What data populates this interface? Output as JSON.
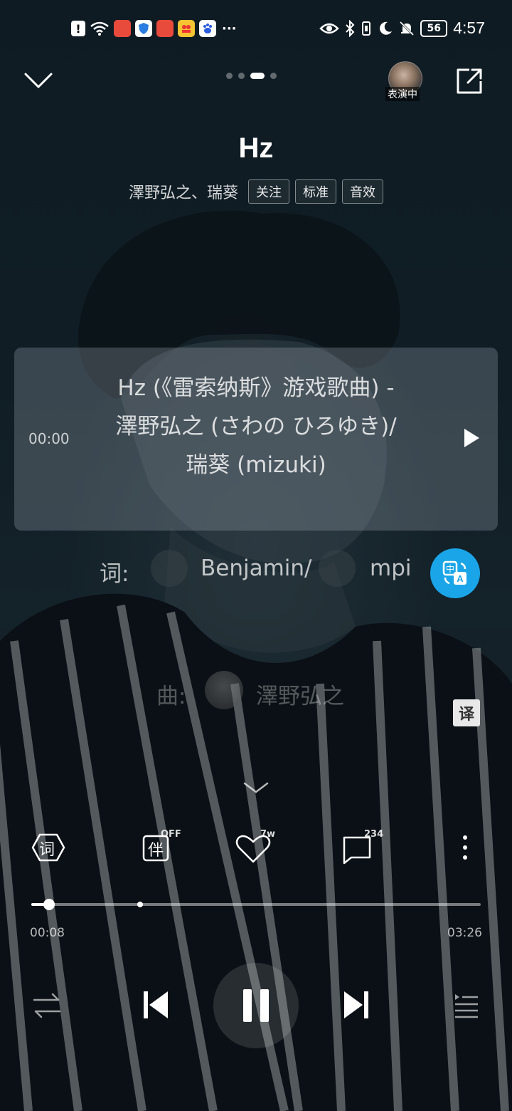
{
  "status_bar": {
    "time": "4:57",
    "battery": "56",
    "more_indicator": "···",
    "icons": [
      "alert-icon",
      "wifi-icon",
      "huawei-app-icon",
      "shield-app-icon",
      "huawei-app-icon-2",
      "video-app-icon",
      "baidu-app-icon",
      "eye-icon",
      "bluetooth-icon",
      "vibrate-icon",
      "moon-icon",
      "mute-bell-icon"
    ]
  },
  "top_bar": {
    "performer_tag": "表演中",
    "page_count": 4,
    "active_page": 3
  },
  "song": {
    "title": "Hz",
    "artists": "澤野弘之、瑞葵",
    "follow_label": "关注",
    "quality_label": "标准",
    "effect_label": "音效"
  },
  "lyric_card": {
    "time": "00:00",
    "line1": "Hz (《雷索纳斯》游戏歌曲) -",
    "line2": "澤野弘之 (さわの ひろゆき)/",
    "line3": "瑞葵 (mizuki)"
  },
  "lyrics": {
    "lyricist_prefix": "词:",
    "lyricist_name_a": "Benjamin/",
    "lyricist_name_b": "mpi",
    "composer_prefix": "曲:",
    "composer_name": "澤野弘之"
  },
  "translate_btn": "译",
  "actions": {
    "lyrics_label": "词",
    "accompany_label": "伴",
    "accompany_badge": "OFF",
    "like_badge": "7w",
    "comment_badge": "234"
  },
  "playback": {
    "elapsed": "00:08",
    "duration": "03:26",
    "progress_fraction": 0.039
  },
  "colors": {
    "accent_blue": "#1aa5e8"
  }
}
